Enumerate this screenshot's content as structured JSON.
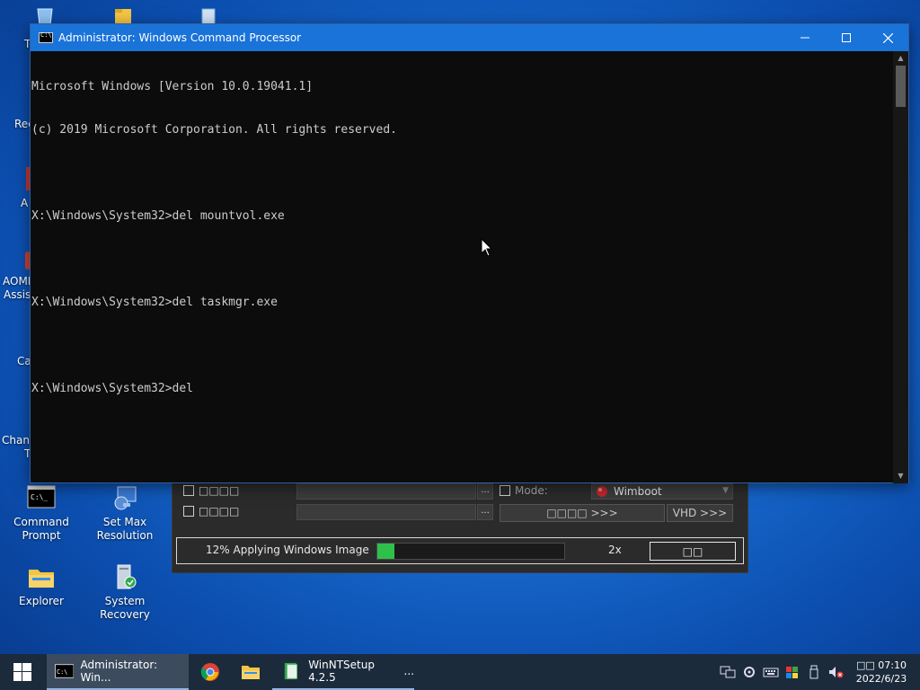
{
  "desktop": {
    "icons": [
      {
        "label": "Command Prompt"
      },
      {
        "label": "Set Max Resolution"
      },
      {
        "label": "Explorer"
      },
      {
        "label": "System Recovery"
      }
    ],
    "partial_labels": [
      "T",
      "Rec",
      "A",
      "AOMI",
      "Assist",
      "Ca",
      "Chang",
      "T"
    ]
  },
  "cmd_window": {
    "title": "Administrator: Windows Command Processor",
    "lines": [
      "Microsoft Windows [Version 10.0.19041.1]",
      "(c) 2019 Microsoft Corporation. All rights reserved.",
      "",
      "X:\\Windows\\System32>del mountvol.exe",
      "",
      "X:\\Windows\\System32>del taskmgr.exe",
      "",
      "X:\\Windows\\System32>del"
    ]
  },
  "winntsetup": {
    "row1_label": "□□□□",
    "row2_label": "□□□□",
    "mode_label": "Mode:",
    "mode_value": "Wimboot",
    "btn_setup": "□□□□ >>>",
    "btn_vhd": "VHD >>>",
    "status_text": "12% Applying Windows Image",
    "progress": 0.09,
    "speed": "2x",
    "cancel_label": "□□"
  },
  "taskbar": {
    "cmd_item": "Administrator: Win...",
    "setup_item": "WinNTSetup 4.2.5",
    "setup_more": "...",
    "clock_time": "□□ 07:10",
    "clock_date": "2022/6/23"
  },
  "colors": {
    "titlebar": "#1a73d9",
    "console_bg": "#0c0c0c",
    "console_text": "#cccccc",
    "progress_fill": "#2ec04a",
    "taskbar_bg": "#1c2b3c"
  }
}
